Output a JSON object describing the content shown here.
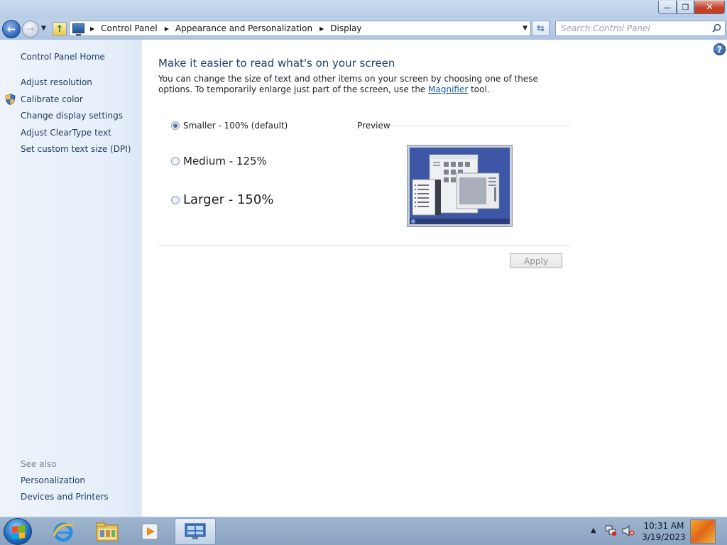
{
  "window": {
    "controls": {
      "minimize": "—",
      "maximize": "❐",
      "close": "✕"
    }
  },
  "nav": {
    "back_icon": "back-arrow-icon",
    "forward_icon": "forward-arrow-icon",
    "breadcrumbs": [
      "Control Panel",
      "Appearance and Personalization",
      "Display"
    ],
    "search_placeholder": "Search Control Panel"
  },
  "sidebar": {
    "home": "Control Panel Home",
    "items": [
      {
        "label": "Adjust resolution"
      },
      {
        "label": "Calibrate color"
      },
      {
        "label": "Change display settings"
      },
      {
        "label": "Adjust ClearType text"
      },
      {
        "label": "Set custom text size (DPI)"
      }
    ],
    "see_also_title": "See also",
    "see_also": [
      {
        "label": "Personalization"
      },
      {
        "label": "Devices and Printers"
      }
    ]
  },
  "main": {
    "heading": "Make it easier to read what's on your screen",
    "desc_pre": "You can change the size of text and other items on your screen by choosing one of these options. To temporarily enlarge just part of the screen, use the ",
    "desc_link": "Magnifier",
    "desc_post": " tool.",
    "options": [
      {
        "label": "Smaller - 100% (default)",
        "selected": true
      },
      {
        "label": "Medium - 125%",
        "selected": false
      },
      {
        "label": "Larger - 150%",
        "selected": false
      }
    ],
    "preview_label": "Preview",
    "apply_label": "Apply"
  },
  "taskbar": {
    "time": "10:31 AM",
    "date": "3/19/2023"
  },
  "colors": {
    "link": "#1e3a5f",
    "heading": "#1e3e6b",
    "accent": "#1a5aa8"
  }
}
